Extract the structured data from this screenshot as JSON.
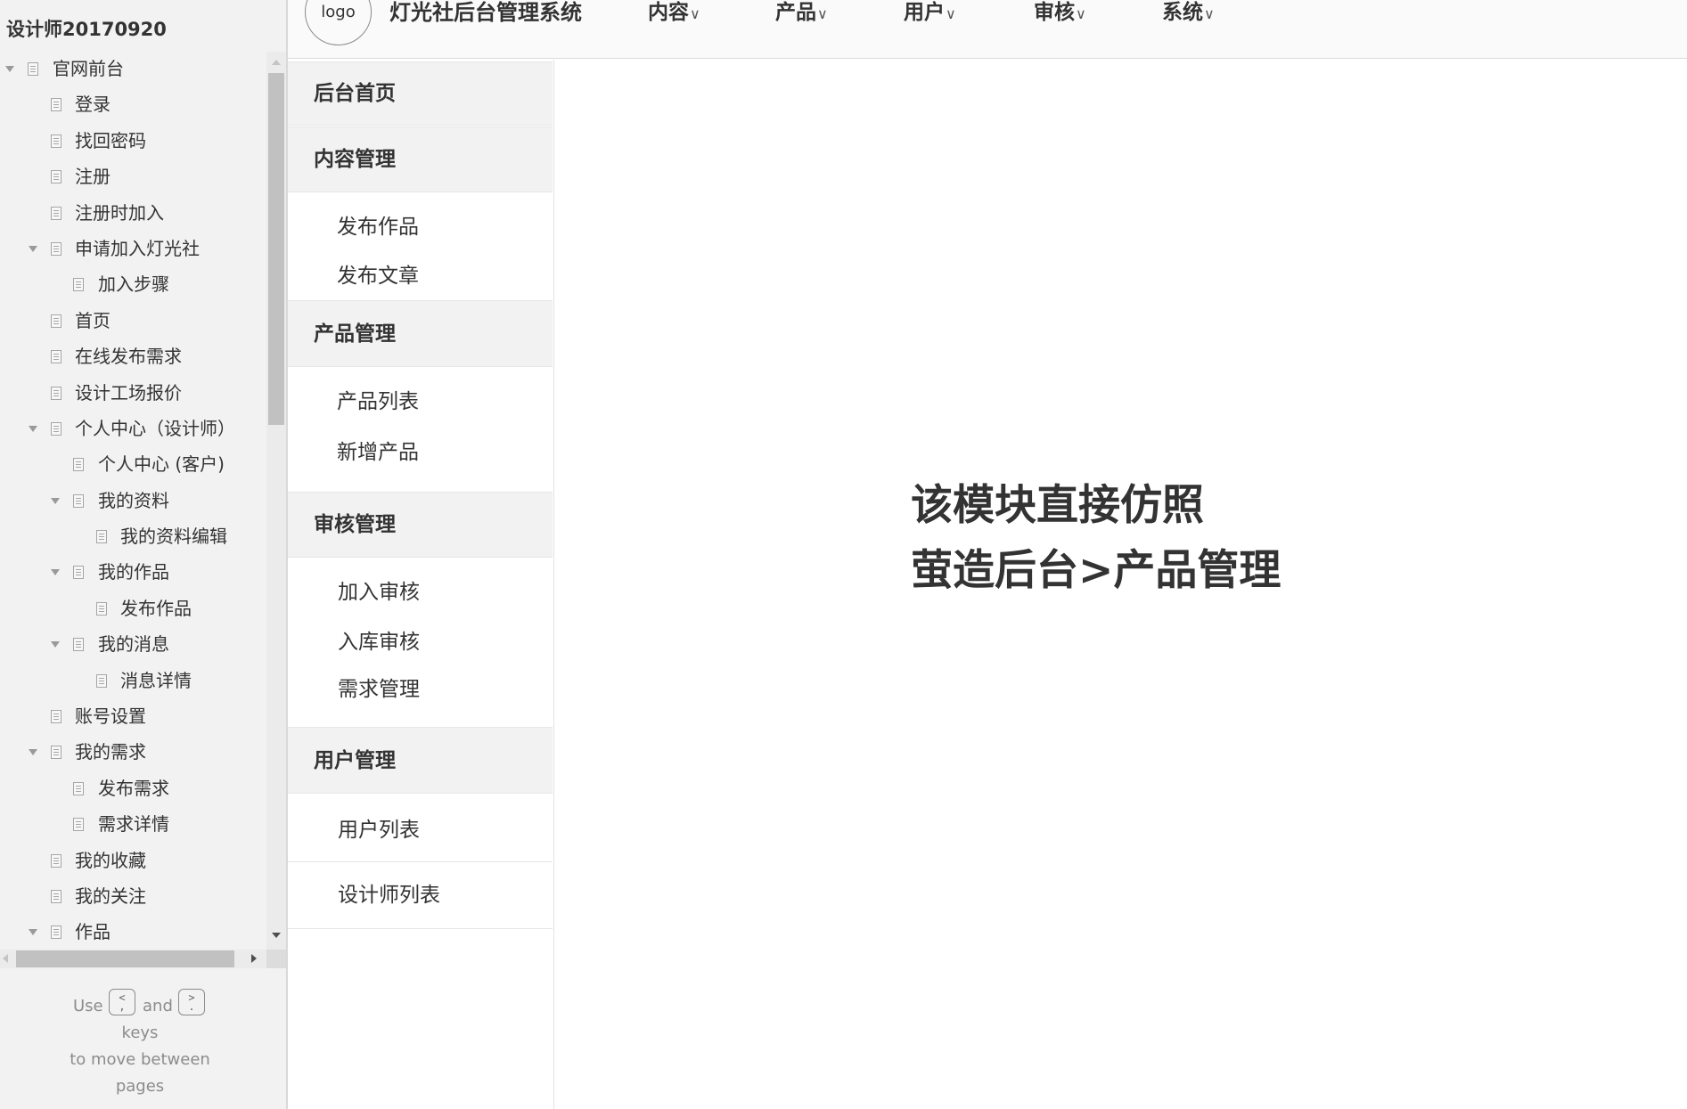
{
  "sitemap": {
    "title": "设计师20170920",
    "items": [
      {
        "label": "官网前台",
        "level": 0,
        "expanded": true
      },
      {
        "label": "登录",
        "level": 1
      },
      {
        "label": "找回密码",
        "level": 1
      },
      {
        "label": "注册",
        "level": 1
      },
      {
        "label": "注册时加入",
        "level": 1
      },
      {
        "label": "申请加入灯光社",
        "level": 1,
        "expanded": true
      },
      {
        "label": "加入步骤",
        "level": 2
      },
      {
        "label": "首页",
        "level": 1
      },
      {
        "label": "在线发布需求",
        "level": 1
      },
      {
        "label": "设计工场报价",
        "level": 1
      },
      {
        "label": "个人中心（设计师）",
        "level": 1,
        "expanded": true
      },
      {
        "label": "个人中心 (客户)",
        "level": 2
      },
      {
        "label": "我的资料",
        "level": 2,
        "expanded": true
      },
      {
        "label": "我的资料编辑",
        "level": 3
      },
      {
        "label": "我的作品",
        "level": 2,
        "expanded": true
      },
      {
        "label": "发布作品",
        "level": 3
      },
      {
        "label": "我的消息",
        "level": 2,
        "expanded": true
      },
      {
        "label": "消息详情",
        "level": 3
      },
      {
        "label": "账号设置",
        "level": 1
      },
      {
        "label": "我的需求",
        "level": 1,
        "expanded": true
      },
      {
        "label": "发布需求",
        "level": 2
      },
      {
        "label": "需求详情",
        "level": 2
      },
      {
        "label": "我的收藏",
        "level": 1
      },
      {
        "label": "我的关注",
        "level": 1
      },
      {
        "label": "作品",
        "level": 1,
        "expanded": true
      }
    ],
    "help": {
      "use": "Use",
      "prev_key": {
        "top": "<",
        "bottom": ","
      },
      "and": "and",
      "next_key": {
        "top": ">",
        "bottom": "."
      },
      "keys": "keys",
      "line_move": "to move between",
      "line_pages": "pages"
    }
  },
  "prototype": {
    "header": {
      "logo": "logo",
      "title": "灯光社后台管理系统",
      "menu": [
        {
          "label": "内容",
          "caret": "∨"
        },
        {
          "label": "产品",
          "caret": "∨"
        },
        {
          "label": "用户",
          "caret": "∨"
        },
        {
          "label": "审核",
          "caret": "∨"
        },
        {
          "label": "系统",
          "caret": "∨"
        }
      ]
    },
    "sidebar": [
      {
        "header": "后台首页",
        "items": []
      },
      {
        "header": "内容管理",
        "items": [
          "发布作品",
          "发布文章"
        ]
      },
      {
        "header": "产品管理",
        "items": [
          "产品列表",
          "新增产品"
        ]
      },
      {
        "header": "审核管理",
        "items": [
          "加入审核",
          "入库审核",
          "需求管理"
        ]
      },
      {
        "header": "用户管理",
        "items": [
          "用户列表",
          "设计师列表"
        ]
      }
    ],
    "content": {
      "line1": "该模块直接仿照",
      "line2": "萤造后台>产品管理"
    }
  },
  "colors": {
    "panel_bg": "#f2f2f2",
    "sidebar_header_bg": "#f2f2f2",
    "text": "#333333",
    "scroll_thumb": "#c1c1c1",
    "help_text": "#8c8c8c"
  }
}
